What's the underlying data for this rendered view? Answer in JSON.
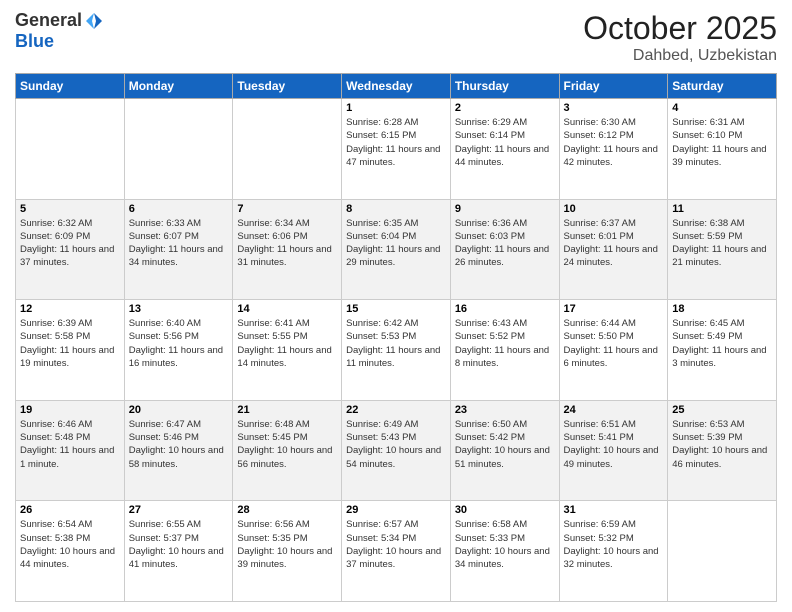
{
  "header": {
    "logo_general": "General",
    "logo_blue": "Blue",
    "month": "October 2025",
    "location": "Dahbed, Uzbekistan"
  },
  "days_of_week": [
    "Sunday",
    "Monday",
    "Tuesday",
    "Wednesday",
    "Thursday",
    "Friday",
    "Saturday"
  ],
  "weeks": [
    [
      {
        "day": "",
        "info": ""
      },
      {
        "day": "",
        "info": ""
      },
      {
        "day": "",
        "info": ""
      },
      {
        "day": "1",
        "info": "Sunrise: 6:28 AM\nSunset: 6:15 PM\nDaylight: 11 hours and 47 minutes."
      },
      {
        "day": "2",
        "info": "Sunrise: 6:29 AM\nSunset: 6:14 PM\nDaylight: 11 hours and 44 minutes."
      },
      {
        "day": "3",
        "info": "Sunrise: 6:30 AM\nSunset: 6:12 PM\nDaylight: 11 hours and 42 minutes."
      },
      {
        "day": "4",
        "info": "Sunrise: 6:31 AM\nSunset: 6:10 PM\nDaylight: 11 hours and 39 minutes."
      }
    ],
    [
      {
        "day": "5",
        "info": "Sunrise: 6:32 AM\nSunset: 6:09 PM\nDaylight: 11 hours and 37 minutes."
      },
      {
        "day": "6",
        "info": "Sunrise: 6:33 AM\nSunset: 6:07 PM\nDaylight: 11 hours and 34 minutes."
      },
      {
        "day": "7",
        "info": "Sunrise: 6:34 AM\nSunset: 6:06 PM\nDaylight: 11 hours and 31 minutes."
      },
      {
        "day": "8",
        "info": "Sunrise: 6:35 AM\nSunset: 6:04 PM\nDaylight: 11 hours and 29 minutes."
      },
      {
        "day": "9",
        "info": "Sunrise: 6:36 AM\nSunset: 6:03 PM\nDaylight: 11 hours and 26 minutes."
      },
      {
        "day": "10",
        "info": "Sunrise: 6:37 AM\nSunset: 6:01 PM\nDaylight: 11 hours and 24 minutes."
      },
      {
        "day": "11",
        "info": "Sunrise: 6:38 AM\nSunset: 5:59 PM\nDaylight: 11 hours and 21 minutes."
      }
    ],
    [
      {
        "day": "12",
        "info": "Sunrise: 6:39 AM\nSunset: 5:58 PM\nDaylight: 11 hours and 19 minutes."
      },
      {
        "day": "13",
        "info": "Sunrise: 6:40 AM\nSunset: 5:56 PM\nDaylight: 11 hours and 16 minutes."
      },
      {
        "day": "14",
        "info": "Sunrise: 6:41 AM\nSunset: 5:55 PM\nDaylight: 11 hours and 14 minutes."
      },
      {
        "day": "15",
        "info": "Sunrise: 6:42 AM\nSunset: 5:53 PM\nDaylight: 11 hours and 11 minutes."
      },
      {
        "day": "16",
        "info": "Sunrise: 6:43 AM\nSunset: 5:52 PM\nDaylight: 11 hours and 8 minutes."
      },
      {
        "day": "17",
        "info": "Sunrise: 6:44 AM\nSunset: 5:50 PM\nDaylight: 11 hours and 6 minutes."
      },
      {
        "day": "18",
        "info": "Sunrise: 6:45 AM\nSunset: 5:49 PM\nDaylight: 11 hours and 3 minutes."
      }
    ],
    [
      {
        "day": "19",
        "info": "Sunrise: 6:46 AM\nSunset: 5:48 PM\nDaylight: 11 hours and 1 minute."
      },
      {
        "day": "20",
        "info": "Sunrise: 6:47 AM\nSunset: 5:46 PM\nDaylight: 10 hours and 58 minutes."
      },
      {
        "day": "21",
        "info": "Sunrise: 6:48 AM\nSunset: 5:45 PM\nDaylight: 10 hours and 56 minutes."
      },
      {
        "day": "22",
        "info": "Sunrise: 6:49 AM\nSunset: 5:43 PM\nDaylight: 10 hours and 54 minutes."
      },
      {
        "day": "23",
        "info": "Sunrise: 6:50 AM\nSunset: 5:42 PM\nDaylight: 10 hours and 51 minutes."
      },
      {
        "day": "24",
        "info": "Sunrise: 6:51 AM\nSunset: 5:41 PM\nDaylight: 10 hours and 49 minutes."
      },
      {
        "day": "25",
        "info": "Sunrise: 6:53 AM\nSunset: 5:39 PM\nDaylight: 10 hours and 46 minutes."
      }
    ],
    [
      {
        "day": "26",
        "info": "Sunrise: 6:54 AM\nSunset: 5:38 PM\nDaylight: 10 hours and 44 minutes."
      },
      {
        "day": "27",
        "info": "Sunrise: 6:55 AM\nSunset: 5:37 PM\nDaylight: 10 hours and 41 minutes."
      },
      {
        "day": "28",
        "info": "Sunrise: 6:56 AM\nSunset: 5:35 PM\nDaylight: 10 hours and 39 minutes."
      },
      {
        "day": "29",
        "info": "Sunrise: 6:57 AM\nSunset: 5:34 PM\nDaylight: 10 hours and 37 minutes."
      },
      {
        "day": "30",
        "info": "Sunrise: 6:58 AM\nSunset: 5:33 PM\nDaylight: 10 hours and 34 minutes."
      },
      {
        "day": "31",
        "info": "Sunrise: 6:59 AM\nSunset: 5:32 PM\nDaylight: 10 hours and 32 minutes."
      },
      {
        "day": "",
        "info": ""
      }
    ]
  ]
}
